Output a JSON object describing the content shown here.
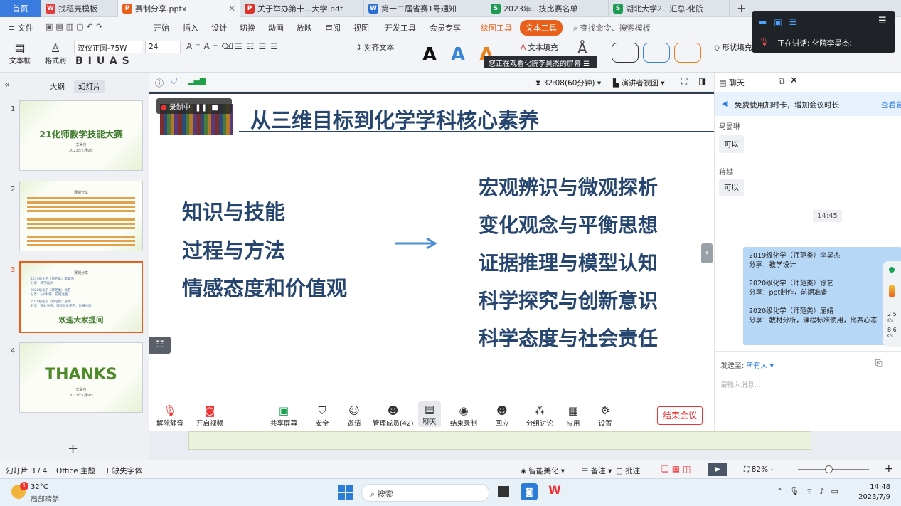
{
  "tabs": [
    {
      "label": "首页",
      "icon": "home-icon"
    },
    {
      "label": "找稻壳模板",
      "icon": "docer-icon"
    },
    {
      "label": "赛制分享.pptx",
      "icon": "pptx-icon"
    },
    {
      "label": "关于举办第十...大学.pdf",
      "icon": "pdf-icon"
    },
    {
      "label": "第十二届省赛1号通知",
      "icon": "word-icon"
    },
    {
      "label": "2023年...技比赛名单",
      "icon": "sheet-icon"
    },
    {
      "label": "湖北大学2...汇总-化院",
      "icon": "sheet-icon"
    }
  ],
  "menu": {
    "file": "文件",
    "items": [
      "开始",
      "插入",
      "设计",
      "切换",
      "动画",
      "放映",
      "审阅",
      "视图",
      "开发工具",
      "会员专享"
    ],
    "draw_tool": "绘图工具",
    "text_tool": "文本工具",
    "search": "查找命令、搜索模板"
  },
  "toolbar": {
    "textbox": "文本框",
    "format_painter": "格式刷",
    "font": "汉仪正圆-75W",
    "size": "24",
    "align_text": "对齐文本",
    "text_fill": "文本填充",
    "shape_fill": "形状填充",
    "watching_banner": "您正在观看化院李昊杰的屏幕"
  },
  "floating": {
    "speaking_label": "正在讲话:",
    "speaker": "化院李昊杰;"
  },
  "left_panel": {
    "tab_outline": "大纲",
    "tab_slides": "幻灯片",
    "slides": [
      {
        "num": "1",
        "title": "21化师教学技能大赛",
        "sub": "李昊杰",
        "date": "2023年7月9日"
      },
      {
        "num": "2",
        "title": "赛制分享"
      },
      {
        "num": "3",
        "title": "赛制分享",
        "lines": [
          "2019级化学（师范类）李昊杰",
          "分享：教学设计",
          "2020级化学（师范类）徐艺",
          "分享：ppt制作，前期准备",
          "2020级化学（师范类）屈婧",
          "分享：教材分析，课程标准使用，比赛心态"
        ],
        "cta": "欢迎大家提问"
      },
      {
        "num": "4",
        "title": "THANKS",
        "sub": "李昊杰",
        "date": "2023年7月9日"
      }
    ],
    "add": "+"
  },
  "meeting_top": {
    "timer": "32:08(60分钟)",
    "view": "演讲者视图"
  },
  "slide": {
    "recording": "录制中",
    "title": "从三维目标到化学学科核心素养",
    "left_items": [
      "知识与技能",
      "过程与方法",
      "情感态度和价值观"
    ],
    "right_items": [
      "宏观辨识与微观探析",
      "变化观念与平衡思想",
      "证据推理与模型认知",
      "科学探究与创新意识",
      "科学态度与社会责任"
    ]
  },
  "meeting_controls": [
    {
      "label": "解除静音",
      "icon": "mic-muted-icon"
    },
    {
      "label": "开启视频",
      "icon": "camera-off-icon"
    },
    {
      "label": "共享屏幕",
      "icon": "share-screen-icon"
    },
    {
      "label": "安全",
      "icon": "shield-icon"
    },
    {
      "label": "邀请",
      "icon": "invite-icon"
    },
    {
      "label": "管理成员(42)",
      "icon": "members-icon"
    },
    {
      "label": "聊天",
      "icon": "chat-icon"
    },
    {
      "label": "结束录制",
      "icon": "record-stop-icon"
    },
    {
      "label": "回应",
      "icon": "reaction-icon"
    },
    {
      "label": "分组讨论",
      "icon": "breakout-icon"
    },
    {
      "label": "应用",
      "icon": "apps-icon"
    },
    {
      "label": "设置",
      "icon": "gear-icon"
    }
  ],
  "end_meeting": "结束会议",
  "chat": {
    "title": "聊天",
    "promo": "免费使用加时卡，增加会议时长",
    "promo_link": "查看更",
    "messages": [
      {
        "sender": "马晏琳",
        "text": "可以"
      },
      {
        "sender": "蒋越",
        "text": "可以"
      }
    ],
    "time": "14:45",
    "shared_lines": [
      "2019级化学（师范类）李昊杰",
      "分享：教学设计",
      "",
      "2020级化学（师范类）徐艺",
      "分享：ppt制作，前期准备",
      "",
      "2020级化学（师范类）屈婧",
      "分享：教材分析，课程标准使用，比赛心态"
    ],
    "send_to_label": "发送至:",
    "send_to": "所有人",
    "placeholder": "请输入消息...",
    "net_up": "2.5",
    "net_up_unit": "K/s",
    "net_down": "8.6",
    "net_down_unit": "K/s"
  },
  "status": {
    "slide_info": "幻灯片 3 / 4",
    "theme": "Office 主题",
    "missing_font": "缺失字体",
    "beautify": "智能美化",
    "notes": "备注",
    "comments": "批注",
    "zoom": "82%"
  },
  "taskbar": {
    "temp": "32°C",
    "weather": "局部晴朗",
    "search": "搜索",
    "time": "14:48",
    "date": "2023/7/9",
    "notify_count": "1"
  }
}
